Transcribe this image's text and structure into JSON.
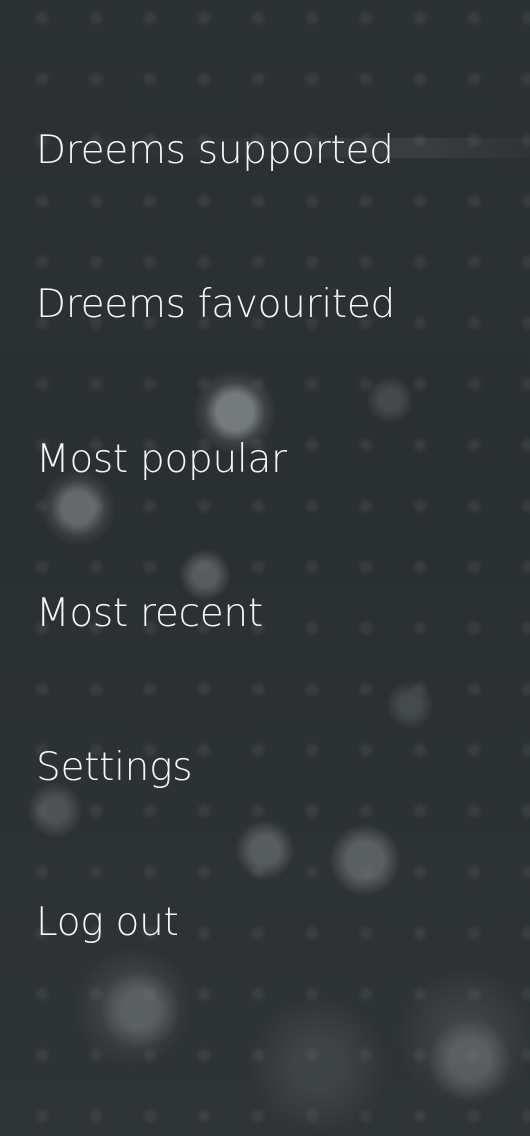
{
  "menu": {
    "items": [
      {
        "label": "Dreems supported"
      },
      {
        "label": "Dreems favourited"
      },
      {
        "label": "Most popular"
      },
      {
        "label": "Most recent"
      },
      {
        "label": "Settings"
      },
      {
        "label": "Log out"
      }
    ]
  },
  "colors": {
    "background": "#2a2e30",
    "text": "#f5f6f6"
  }
}
